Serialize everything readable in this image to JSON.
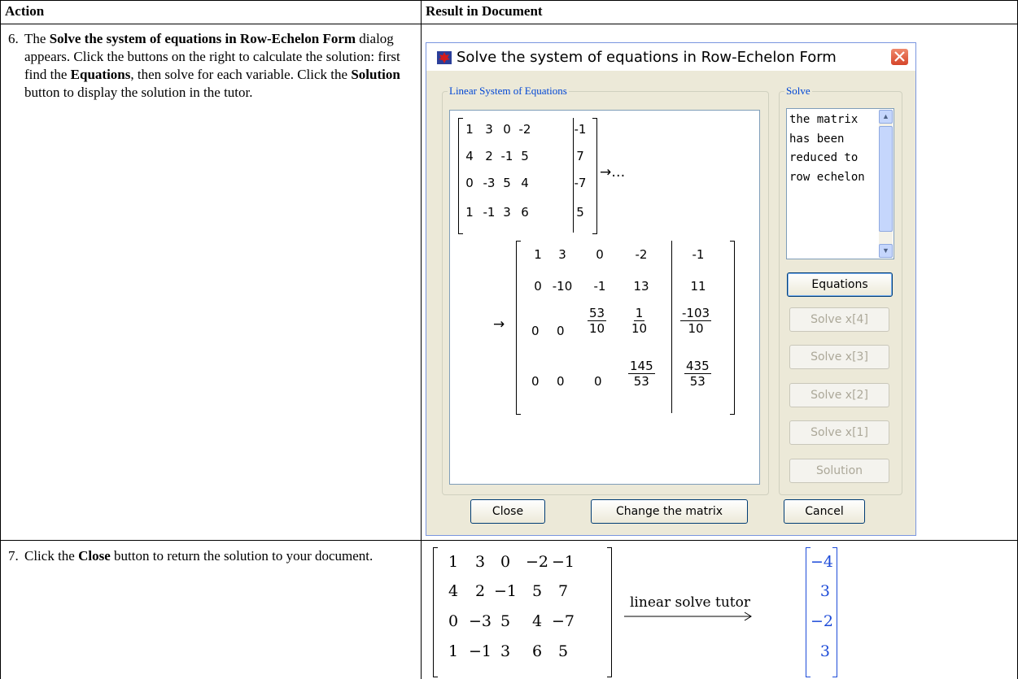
{
  "table": {
    "header_action": "Action",
    "header_result": "Result in Document"
  },
  "step6": {
    "number": "6.",
    "part1": "The ",
    "bold1": "Solve the system of equations in Row-Echelon Form",
    "part2": " dialog appears. Click the buttons on the right to calculate the solution: first find the ",
    "bold2": "Equations",
    "part3": ", then solve for each variable. Click the ",
    "bold3": "Solution",
    "part4": " button to display the solution in the tutor."
  },
  "step7": {
    "number": "7.",
    "part1": "Click the ",
    "bold1": "Close",
    "part2": " button to return the solution to your document."
  },
  "dialog": {
    "title": "Solve the system of equations in Row-Echelon Form",
    "group_left": "Linear System of Equations",
    "group_right": "Solve",
    "status_text": "the matrix has been reduced to row echelon",
    "buttons": {
      "equations": "Equations",
      "solve_x4": "Solve x[4]",
      "solve_x3": "Solve x[3]",
      "solve_x2": "Solve x[2]",
      "solve_x1": "Solve x[1]",
      "solution": "Solution",
      "close": "Close",
      "change": "Change the matrix",
      "cancel": "Cancel"
    },
    "arrow_ellipsis": "→…",
    "arrow": "→",
    "matrix_original": [
      [
        "1",
        "3",
        "0",
        "-2",
        "-1"
      ],
      [
        "4",
        "2",
        "-1",
        "5",
        "7"
      ],
      [
        "0",
        "-3",
        "5",
        "4",
        "-7"
      ],
      [
        "1",
        "-1",
        "3",
        "6",
        "5"
      ]
    ],
    "matrix_reduced_simple": [
      [
        "1",
        "3",
        "0",
        "-2",
        "-1"
      ],
      [
        "0",
        "-10",
        "-1",
        "13",
        "11"
      ]
    ],
    "frac_row3": {
      "c1": "0",
      "c2": "0",
      "c3n": "53",
      "c3d": "10",
      "c4n": "1",
      "c4d": "10",
      "c5n": "-103",
      "c5d": "10"
    },
    "frac_row4": {
      "c1": "0",
      "c2": "0",
      "c3": "0",
      "c4n": "145",
      "c4d": "53",
      "c5n": "435",
      "c5d": "53"
    }
  },
  "result": {
    "matrix": [
      [
        "1",
        "3",
        "0",
        "−2",
        "−1"
      ],
      [
        "4",
        "2",
        "−1",
        "5",
        "7"
      ],
      [
        "0",
        "−3",
        "5",
        "4",
        "−7"
      ],
      [
        "1",
        "−1",
        "3",
        "6",
        "5"
      ]
    ],
    "arrow_label": "linear solve tutor",
    "solution": [
      "−4",
      "3",
      "−2",
      "3"
    ],
    "solution_color": "#1d4bd8"
  }
}
